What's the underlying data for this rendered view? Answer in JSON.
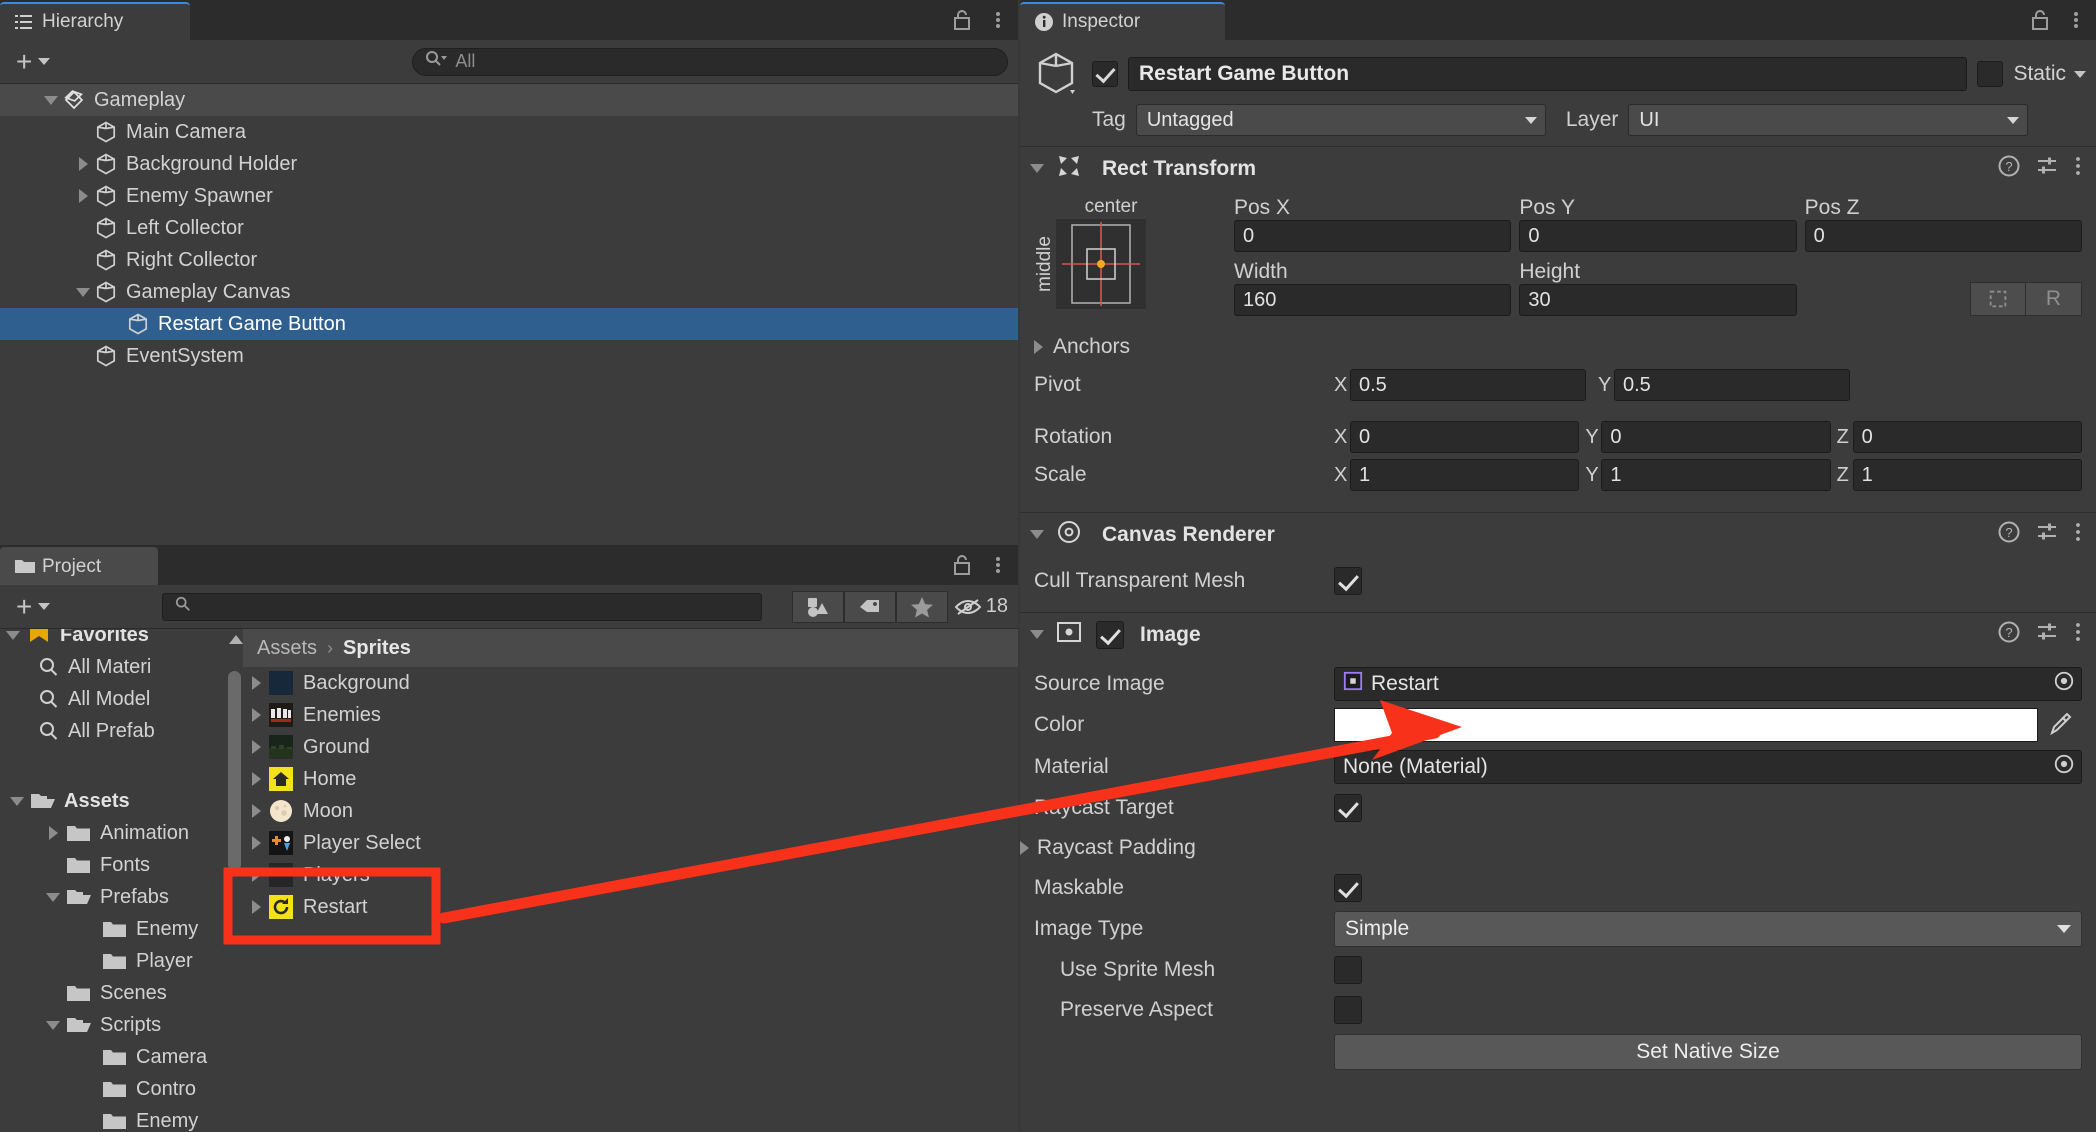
{
  "hierarchy": {
    "tab_label": "Hierarchy",
    "tab_icon": "hierarchy-icon",
    "search_placeholder": "All",
    "items": [
      {
        "label": "Gameplay",
        "depth": 1,
        "twirl": "down",
        "icon": "unity-scene-icon",
        "state": "root"
      },
      {
        "label": "Main Camera",
        "depth": 2,
        "twirl": "none",
        "icon": "gameobject-cube-icon",
        "state": "normal"
      },
      {
        "label": "Background Holder",
        "depth": 2,
        "twirl": "right",
        "icon": "gameobject-cube-icon",
        "state": "normal"
      },
      {
        "label": "Enemy Spawner",
        "depth": 2,
        "twirl": "right",
        "icon": "gameobject-cube-icon",
        "state": "normal"
      },
      {
        "label": "Left Collector",
        "depth": 2,
        "twirl": "none",
        "icon": "gameobject-cube-icon",
        "state": "normal"
      },
      {
        "label": "Right Collector",
        "depth": 2,
        "twirl": "none",
        "icon": "gameobject-cube-icon",
        "state": "normal"
      },
      {
        "label": "Gameplay Canvas",
        "depth": 2,
        "twirl": "down",
        "icon": "gameobject-cube-icon",
        "state": "normal"
      },
      {
        "label": "Restart Game Button",
        "depth": 3,
        "twirl": "none",
        "icon": "gameobject-cube-icon",
        "state": "selected"
      },
      {
        "label": "EventSystem",
        "depth": 2,
        "twirl": "none",
        "icon": "gameobject-cube-icon",
        "state": "normal"
      }
    ]
  },
  "project": {
    "tab_label": "Project",
    "tab_icon": "folder-icon",
    "search_placeholder": "",
    "hidden_count": "18",
    "tools": [
      "asset-type-filter-icon",
      "label-tag-icon",
      "favorite-star-icon"
    ],
    "favorites": {
      "label": "Favorites",
      "items": [
        "All Materi",
        "All Model",
        "All Prefab"
      ]
    },
    "tree": [
      {
        "label": "Assets",
        "depth": 0,
        "twirl": "down",
        "bold": true,
        "folder": "open"
      },
      {
        "label": "Animation",
        "depth": 1,
        "twirl": "right",
        "bold": false,
        "folder": "closed"
      },
      {
        "label": "Fonts",
        "depth": 1,
        "twirl": "none",
        "bold": false,
        "folder": "closed"
      },
      {
        "label": "Prefabs",
        "depth": 1,
        "twirl": "down",
        "bold": false,
        "folder": "open"
      },
      {
        "label": "Enemy",
        "depth": 2,
        "twirl": "none",
        "bold": false,
        "folder": "closed"
      },
      {
        "label": "Player",
        "depth": 2,
        "twirl": "none",
        "bold": false,
        "folder": "closed"
      },
      {
        "label": "Scenes",
        "depth": 1,
        "twirl": "none",
        "bold": false,
        "folder": "closed"
      },
      {
        "label": "Scripts",
        "depth": 1,
        "twirl": "down",
        "bold": false,
        "folder": "open"
      },
      {
        "label": "Camera",
        "depth": 2,
        "twirl": "none",
        "bold": false,
        "folder": "closed"
      },
      {
        "label": "Contro",
        "depth": 2,
        "twirl": "none",
        "bold": false,
        "folder": "closed"
      },
      {
        "label": "Enemy",
        "depth": 2,
        "twirl": "none",
        "bold": false,
        "folder": "closed"
      }
    ],
    "breadcrumb": {
      "root": "Assets",
      "sep": "›",
      "current": "Sprites"
    },
    "assets": [
      {
        "label": "Background",
        "thumb": "#16283a",
        "kind": "sprite"
      },
      {
        "label": "Enemies",
        "thumb": "#3a2a24",
        "kind": "sprite"
      },
      {
        "label": "Ground",
        "thumb": "#1e2a1c",
        "kind": "sprite"
      },
      {
        "label": "Home",
        "thumb": "#f3e21a",
        "kind": "sprite"
      },
      {
        "label": "Moon",
        "thumb": "#f0e2c8",
        "kind": "sprite"
      },
      {
        "label": "Player Select",
        "thumb": "#1a1a1a",
        "kind": "sprite"
      },
      {
        "label": "Players",
        "thumb": "#2a2a2a",
        "kind": "sprite"
      },
      {
        "label": "Restart",
        "thumb": "#f3e21a",
        "kind": "sprite"
      }
    ]
  },
  "inspector": {
    "tab_label": "Inspector",
    "tab_icon": "info-icon",
    "gameobject": {
      "enabled": true,
      "name": "Restart Game Button",
      "static_label": "Static",
      "static_checked": false,
      "tag_label": "Tag",
      "tag_value": "Untagged",
      "layer_label": "Layer",
      "layer_value": "UI"
    },
    "components": [
      {
        "title": "Rect Transform",
        "icon": "rect-transform-icon",
        "expanded": true,
        "anchor_preset": {
          "top": "center",
          "left": "middle"
        },
        "fields": {
          "pos_x_label": "Pos X",
          "pos_x": "0",
          "pos_y_label": "Pos Y",
          "pos_y": "0",
          "pos_z_label": "Pos Z",
          "pos_z": "0",
          "width_label": "Width",
          "width": "160",
          "height_label": "Height",
          "height": "30",
          "blueprint_button": "blueprint-mode-icon",
          "raw_button": "R",
          "anchors_label": "Anchors",
          "pivot_label": "Pivot",
          "pivot_x": "0.5",
          "pivot_y": "0.5",
          "rotation_label": "Rotation",
          "rot_x": "0",
          "rot_y": "0",
          "rot_z": "0",
          "scale_label": "Scale",
          "scale_x": "1",
          "scale_y": "1",
          "scale_z": "1"
        }
      },
      {
        "title": "Canvas Renderer",
        "icon": "canvas-renderer-icon",
        "expanded": true,
        "rows": [
          {
            "label": "Cull Transparent Mesh",
            "type": "checkbox",
            "value": true
          }
        ]
      },
      {
        "title": "Image",
        "icon": "image-component-icon",
        "expanded": true,
        "enabled": true,
        "rows": [
          {
            "label": "Source Image",
            "type": "object",
            "value": "Restart",
            "icon": "sprite-icon"
          },
          {
            "label": "Color",
            "type": "color",
            "value": "#ffffff"
          },
          {
            "label": "Material",
            "type": "object",
            "value": "None (Material)"
          },
          {
            "label": "Raycast Target",
            "type": "checkbox",
            "value": true
          },
          {
            "label": "Raycast Padding",
            "type": "foldout",
            "value": ""
          },
          {
            "label": "Maskable",
            "type": "checkbox",
            "value": true
          },
          {
            "label": "Image Type",
            "type": "dropdown",
            "value": "Simple"
          },
          {
            "label": "Use Sprite Mesh",
            "type": "checkbox",
            "value": false,
            "indent": true
          },
          {
            "label": "Preserve Aspect",
            "type": "checkbox",
            "value": false,
            "indent": true
          }
        ],
        "button": "Set Native Size"
      }
    ]
  },
  "annotation": {
    "color": "#f8311b",
    "arrow_name": "red-arrow-annotation",
    "box_project_name": "red-box-restart-asset",
    "box_inspector_name": "red-highlight-source-image"
  }
}
